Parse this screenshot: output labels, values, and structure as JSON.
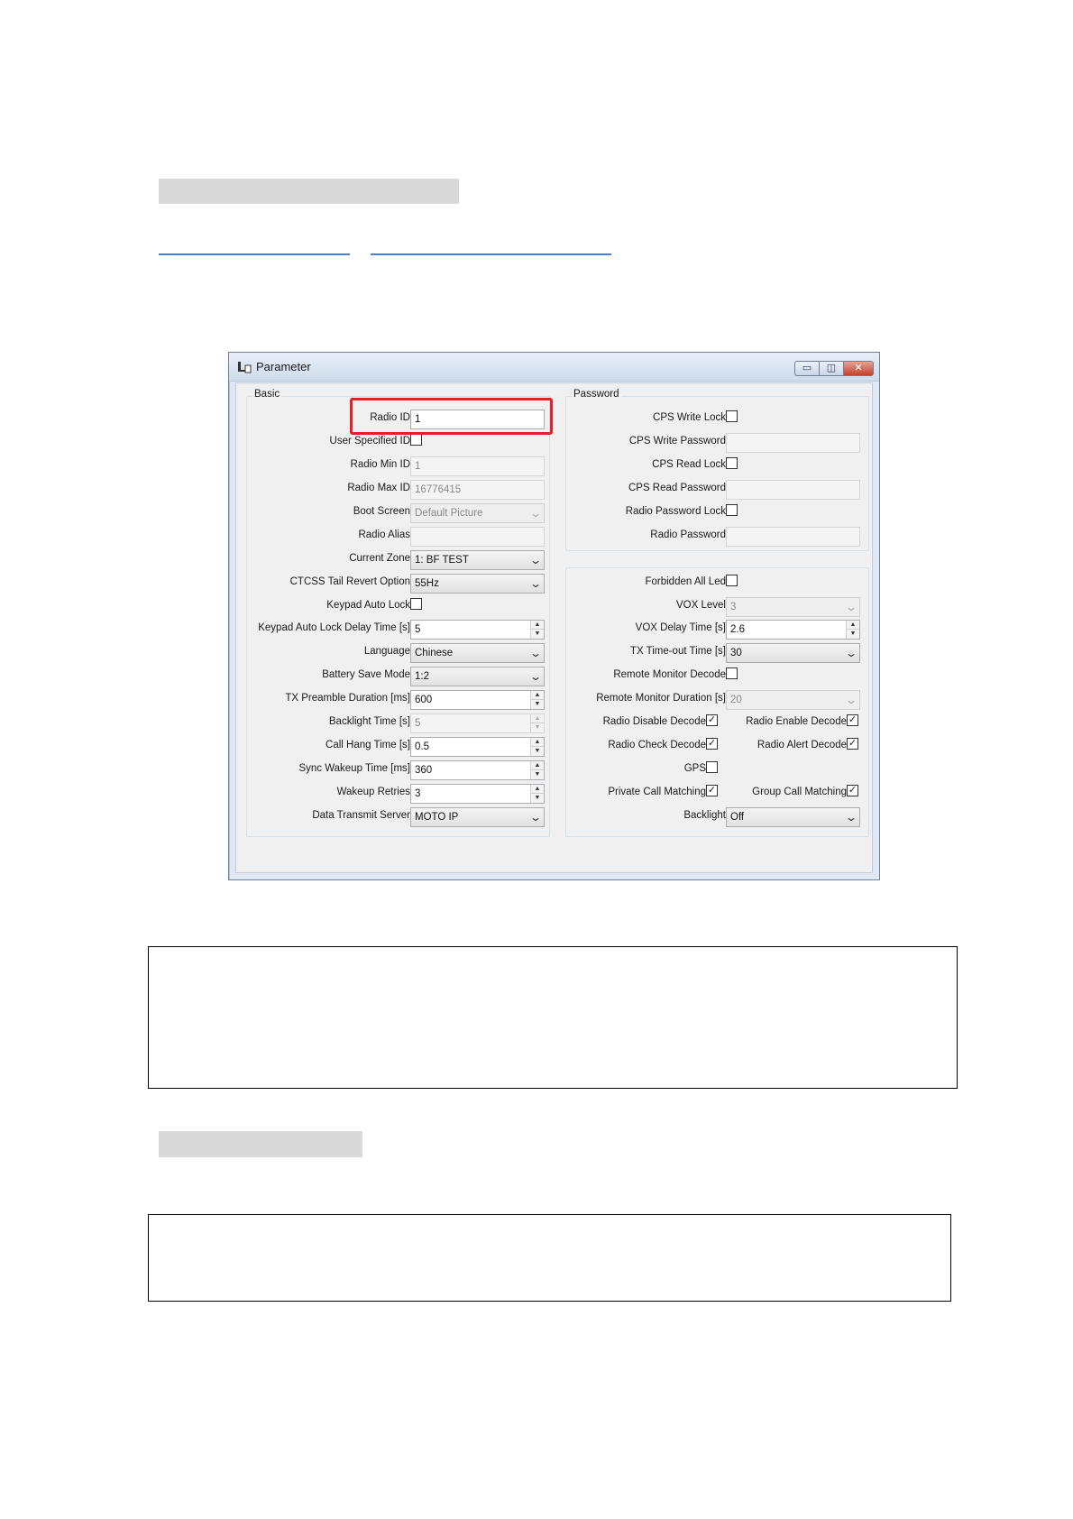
{
  "window": {
    "title": "Parameter",
    "controls": {
      "minimize": "▭",
      "maximize": "◫",
      "close": "✕"
    }
  },
  "basic": {
    "group_label": "Basic",
    "radio_id": {
      "label": "Radio ID",
      "value": "1"
    },
    "user_specified_id": {
      "label": "User Specified ID",
      "checked": false
    },
    "radio_min_id": {
      "label": "Radio Min ID",
      "value": "1"
    },
    "radio_max_id": {
      "label": "Radio Max ID",
      "value": "16776415"
    },
    "boot_screen": {
      "label": "Boot Screen",
      "value": "Default Picture"
    },
    "radio_alias": {
      "label": "Radio Alias",
      "value": ""
    },
    "current_zone": {
      "label": "Current Zone",
      "value": "1: BF TEST"
    },
    "ctcss_tail": {
      "label": "CTCSS Tail Revert Option",
      "value": "55Hz"
    },
    "keypad_auto_lock": {
      "label": "Keypad Auto Lock",
      "checked": false
    },
    "keypad_lock_delay": {
      "label": "Keypad Auto Lock Delay Time [s]",
      "value": "5"
    },
    "language": {
      "label": "Language",
      "value": "Chinese"
    },
    "battery_save": {
      "label": "Battery Save Mode",
      "value": "1:2"
    },
    "tx_preamble": {
      "label": "TX Preamble Duration [ms]",
      "value": "600"
    },
    "backlight_time": {
      "label": "Backlight Time [s]",
      "value": "5"
    },
    "call_hang": {
      "label": "Call Hang Time [s]",
      "value": "0.5"
    },
    "sync_wakeup": {
      "label": "Sync Wakeup Time [ms]",
      "value": "360"
    },
    "wakeup_retries": {
      "label": "Wakeup Retries",
      "value": "3"
    },
    "data_server": {
      "label": "Data Transmit Server",
      "value": "MOTO IP"
    }
  },
  "password": {
    "group_label": "Password",
    "cps_write_lock": {
      "label": "CPS Write Lock",
      "checked": false
    },
    "cps_write_password": {
      "label": "CPS Write Password",
      "value": ""
    },
    "cps_read_lock": {
      "label": "CPS Read Lock",
      "checked": false
    },
    "cps_read_password": {
      "label": "CPS Read Password",
      "value": ""
    },
    "radio_password_lock": {
      "label": "Radio Password Lock",
      "checked": false
    },
    "radio_password": {
      "label": "Radio Password",
      "value": ""
    }
  },
  "other": {
    "forbidden_all_led": {
      "label": "Forbidden All Led",
      "checked": false
    },
    "vox_level": {
      "label": "VOX Level",
      "value": "3"
    },
    "vox_delay": {
      "label": "VOX Delay Time [s]",
      "value": "2.6"
    },
    "tx_timeout": {
      "label": "TX Time-out Time [s]",
      "value": "30"
    },
    "remote_monitor_decode": {
      "label": "Remote Monitor Decode",
      "checked": false
    },
    "remote_monitor_duration": {
      "label": "Remote Monitor Duration [s]",
      "value": "20"
    },
    "radio_disable_decode": {
      "label": "Radio Disable Decode",
      "checked": true
    },
    "radio_enable_decode": {
      "label": "Radio Enable Decode",
      "checked": true
    },
    "radio_check_decode": {
      "label": "Radio Check Decode",
      "checked": true
    },
    "radio_alert_decode": {
      "label": "Radio Alert Decode",
      "checked": true
    },
    "gps": {
      "label": "GPS",
      "checked": false
    },
    "private_call_matching": {
      "label": "Private Call Matching",
      "checked": true
    },
    "group_call_matching": {
      "label": "Group Call Matching",
      "checked": true
    },
    "backlight": {
      "label": "Backlight",
      "value": "Off"
    }
  },
  "glyphs": {
    "check": "✓",
    "arrow": "⌄",
    "up": "▲",
    "down": "▼"
  }
}
